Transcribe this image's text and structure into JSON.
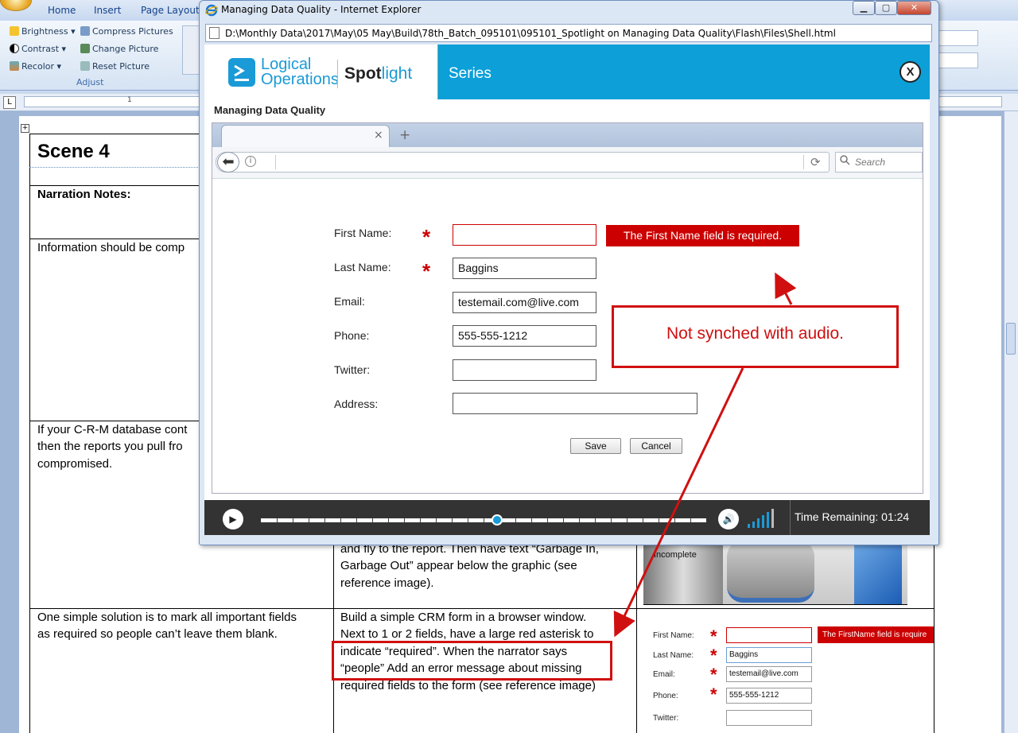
{
  "word": {
    "tabs": [
      "Home",
      "Insert",
      "Page Layout"
    ],
    "ribbon_items": {
      "brightness": "Brightness",
      "contrast": "Contrast",
      "recolor": "Recolor",
      "compress": "Compress Pictures",
      "change": "Change Picture",
      "reset": "Reset Picture"
    },
    "group_label": "Adjust",
    "ruler_mark": "1",
    "doc": {
      "scene_title": "Scene 4",
      "narration_header": "Narration Notes:",
      "row1_narration": "Information should be comp",
      "row2_narration_1": "If your C-R-M database cont",
      "row2_narration_2": "then the reports you pull fro",
      "row2_narration_3": "compromised.",
      "row2_visual_1": "and fly to the report. Then have text “Garbage In,",
      "row2_visual_2": "Garbage Out” appear below the graphic (see",
      "row2_visual_3": "reference image).",
      "row2_image_label": "Incomplete",
      "row3_narration_1": "One simple solution is to mark all important fields",
      "row3_narration_2": "as required so people can’t leave them blank.",
      "row3_visual_1": "Build a simple CRM form in a browser window.",
      "row3_visual_2": "Next to 1 or 2 fields, have a large red asterisk to",
      "row3_visual_3": "indicate “required”. When the narrator says",
      "row3_visual_4": "“people” Add an error message about missing",
      "row3_visual_5": "required fields to the form (see reference image)",
      "ref": {
        "first_name": "First Name:",
        "last_name": "Last Name:",
        "email": "Email:",
        "phone": "Phone:",
        "twitter": "Twitter:",
        "last_value": "Baggins",
        "email_value": "testemail@live.com",
        "phone_value": "555-555-1212",
        "error": "The FirstName field is require"
      }
    }
  },
  "ie": {
    "title": "Managing Data Quality - Internet Explorer",
    "address": "D:\\Monthly Data\\2017\\May\\05 May\\Build\\78th_Batch_095101\\095101_Spotlight on Managing Data Quality\\Flash\\Files\\Shell.html",
    "logo_line1": "Logical",
    "logo_line2": "Operations",
    "logo_spot": "Spot",
    "logo_light": "light",
    "series": "Series",
    "close": "X",
    "course_title": "Managing Data Quality",
    "browser": {
      "search_placeholder": "Search",
      "close_tab": "×",
      "new_tab": "+"
    },
    "form": {
      "first_name_label": "First Name:",
      "last_name_label": "Last Name:",
      "email_label": "Email:",
      "phone_label": "Phone:",
      "twitter_label": "Twitter:",
      "address_label": "Address:",
      "first_name_value": "",
      "last_name_value": "Baggins",
      "email_value": "testemail.com@live.com",
      "phone_value": "555-555-1212",
      "twitter_value": "",
      "address_value": "",
      "required_star": "*",
      "error": "The First Name field is required.",
      "save": "Save",
      "cancel": "Cancel"
    },
    "player": {
      "progress": 0.53,
      "time_remaining": "Time Remaining: 01:24"
    }
  },
  "annotation": {
    "callout": "Not synched with audio.",
    "color": "#d01010"
  }
}
